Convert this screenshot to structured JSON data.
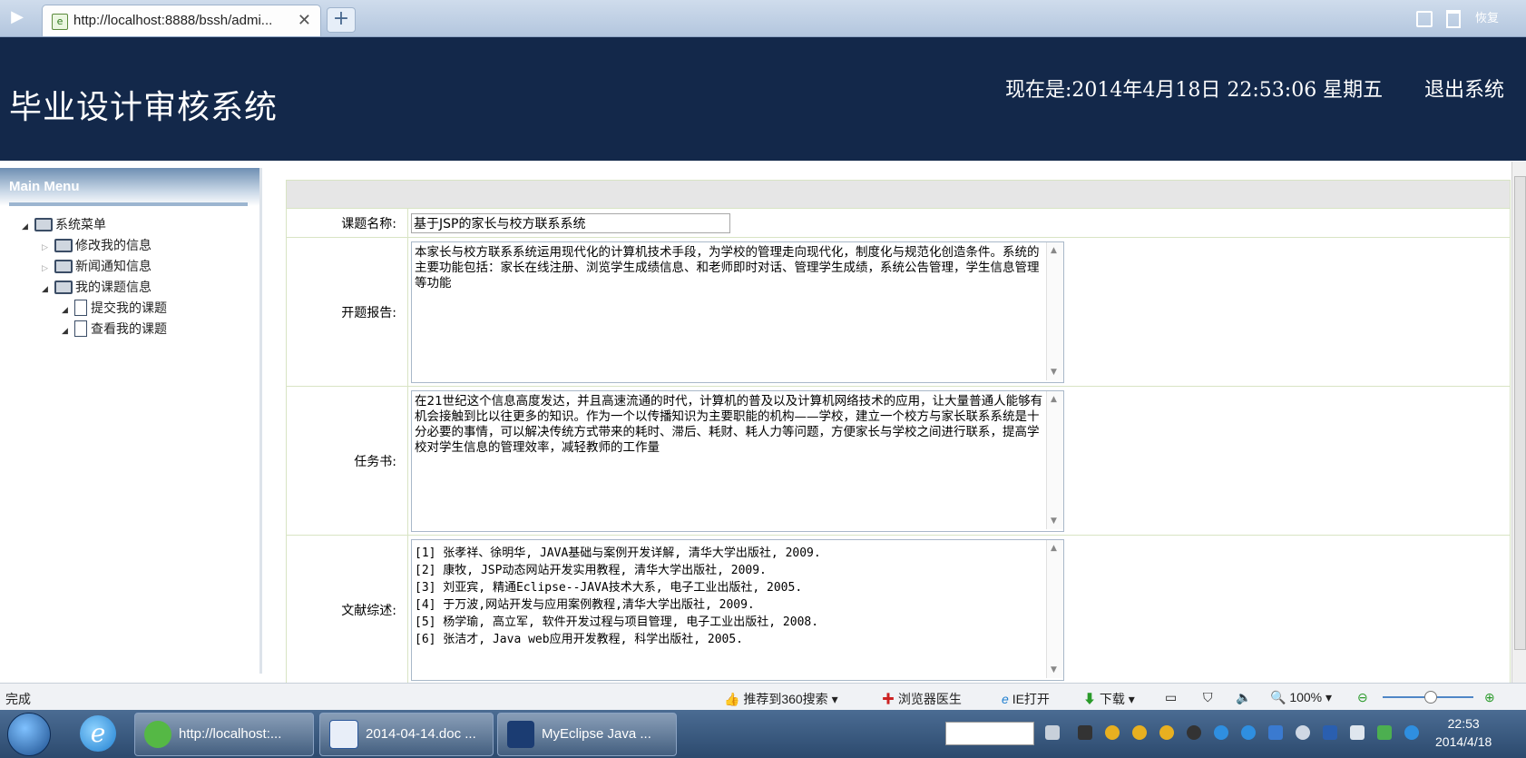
{
  "browser": {
    "tab_title": "http://localhost:8888/bssh/admi...",
    "tab_close": "✕",
    "new_tab": "+",
    "restore_label": "恢复"
  },
  "header": {
    "app_title": "毕业设计审核系统",
    "clock": "现在是:2014年4月18日  22:53:06 星期五",
    "logout": "退出系统"
  },
  "menu": {
    "title": "Main Menu",
    "root": "系统菜单",
    "items": [
      {
        "label": "修改我的信息"
      },
      {
        "label": "新闻通知信息"
      },
      {
        "label": "我的课题信息"
      }
    ],
    "subitems": [
      {
        "label": "提交我的课题"
      },
      {
        "label": "查看我的课题"
      }
    ]
  },
  "form": {
    "title_label": "课题名称:",
    "title_value": "基于JSP的家长与校方联系系统",
    "proposal_label": "开题报告:",
    "proposal_value": "本家长与校方联系系统运用现代化的计算机技术手段，为学校的管理走向现代化，制度化与规范化创造条件。系统的主要功能包括：家长在线注册、浏览学生成绩信息、和老师即时对话、管理学生成绩，系统公告管理，学生信息管理等功能",
    "task_label": "任务书:",
    "task_value": "在21世纪这个信息高度发达，并且高速流通的时代，计算机的普及以及计算机网络技术的应用，让大量普通人能够有机会接触到比以往更多的知识。作为一个以传播知识为主要职能的机构——学校，建立一个校方与家长联系系统是十分必要的事情，可以解决传统方式带来的耗时、滞后、耗财、耗人力等问题，方便家长与学校之间进行联系，提高学校对学生信息的管理效率，减轻教师的工作量",
    "refs_label": "文献综述:",
    "refs_value": "[1] 张孝祥、徐明华, JAVA基础与案例开发详解, 清华大学出版社, 2009.\n[2] 康牧, JSP动态网站开发实用教程, 清华大学出版社, 2009.\n[3] 刘亚宾, 精通Eclipse--JAVA技术大系, 电子工业出版社, 2005.\n[4] 于万波,网站开发与应用案例教程,清华大学出版社, 2009.\n[5] 杨学瑜, 高立军, 软件开发过程与项目管理, 电子工业出版社, 2008.\n[6] 张洁才, Java web应用开发教程, 科学出版社, 2005."
  },
  "statusbar": {
    "status": "完成",
    "recommend": "推荐到360搜索",
    "doctor": "浏览器医生",
    "ie_open": "IE打开",
    "download": "下载",
    "zoom": "100%"
  },
  "taskbar": {
    "tasks": [
      {
        "label": "http://localhost:..."
      },
      {
        "label": "2014-04-14.doc ..."
      },
      {
        "label": "MyEclipse Java ..."
      }
    ],
    "time": "22:53",
    "date": "2014/4/18"
  },
  "colors": {
    "header_bg": "#13284a",
    "tab_strip": "#b3c6de",
    "table_border": "#d8e4c4"
  }
}
